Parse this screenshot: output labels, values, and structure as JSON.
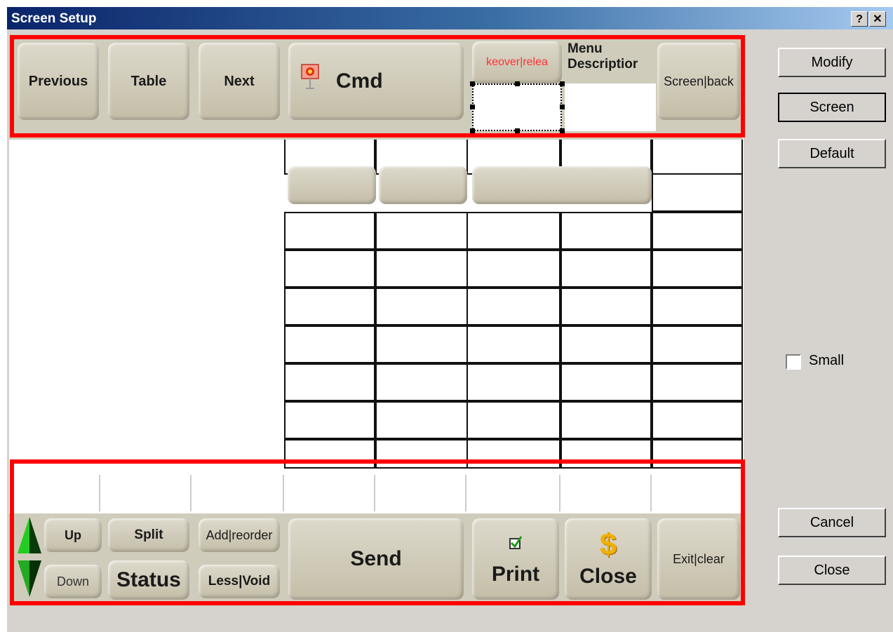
{
  "window": {
    "title": "Screen Setup",
    "help": "?",
    "close": "✕"
  },
  "top_bar": {
    "previous": "Previous",
    "table": "Table",
    "next": "Next",
    "cmd": "Cmd",
    "takeover": "keover|relea",
    "menu_desc": "Menu Descriptior",
    "screen_back": "Screen|back"
  },
  "bottom_bar": {
    "up": "Up",
    "down": "Down",
    "split": "Split",
    "status": "Status",
    "add_reorder": "Add|reorder",
    "less_void": "Less|Void",
    "send": "Send",
    "print": "Print",
    "close": "Close",
    "exit_clear": "Exit|clear"
  },
  "side": {
    "modify": "Modify",
    "screen": "Screen",
    "default": "Default",
    "small": "Small",
    "cancel": "Cancel",
    "close": "Close"
  },
  "colors": {
    "highlight": "#ff0000",
    "takeover_text": "#ff3030",
    "dollar": "#f0b000"
  },
  "icons": [
    "cmd-icon",
    "up-arrow-icon",
    "down-arrow-icon",
    "checkmark-icon",
    "dollar-icon"
  ]
}
